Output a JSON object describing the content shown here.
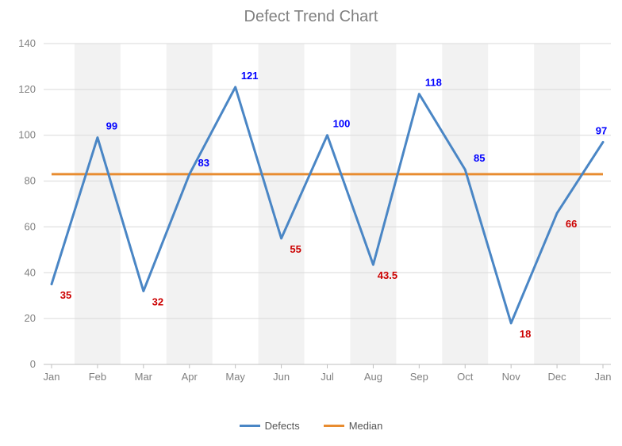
{
  "chart_data": {
    "type": "line",
    "title": "Defect Trend Chart",
    "categories": [
      "Jan",
      "Feb",
      "Mar",
      "Apr",
      "May",
      "Jun",
      "Jul",
      "Aug",
      "Sep",
      "Oct",
      "Nov",
      "Dec",
      "Jan"
    ],
    "series": [
      {
        "name": "Defects",
        "color": "#4a86c5",
        "values": [
          35,
          99,
          32,
          83,
          121,
          55,
          100,
          43.5,
          118,
          85,
          18,
          66,
          97
        ],
        "labels": [
          {
            "i": 0,
            "text": "35",
            "pos": "low"
          },
          {
            "i": 1,
            "text": "99",
            "pos": "high"
          },
          {
            "i": 2,
            "text": "32",
            "pos": "low"
          },
          {
            "i": 3,
            "text": "83",
            "pos": "high"
          },
          {
            "i": 4,
            "text": "121",
            "pos": "high"
          },
          {
            "i": 5,
            "text": "55",
            "pos": "low"
          },
          {
            "i": 6,
            "text": "100",
            "pos": "high"
          },
          {
            "i": 7,
            "text": "43.5",
            "pos": "low"
          },
          {
            "i": 8,
            "text": "118",
            "pos": "high"
          },
          {
            "i": 9,
            "text": "85",
            "pos": "high"
          },
          {
            "i": 10,
            "text": "18",
            "pos": "low"
          },
          {
            "i": 11,
            "text": "66",
            "pos": "low"
          },
          {
            "i": 12,
            "text": "97",
            "pos": "high"
          }
        ]
      },
      {
        "name": "Median",
        "color": "#e88c30",
        "constant": 83
      }
    ],
    "xlabel": "",
    "ylabel": "",
    "ylim": [
      0,
      140
    ],
    "yticks": [
      0,
      20,
      40,
      60,
      80,
      100,
      120,
      140
    ]
  }
}
